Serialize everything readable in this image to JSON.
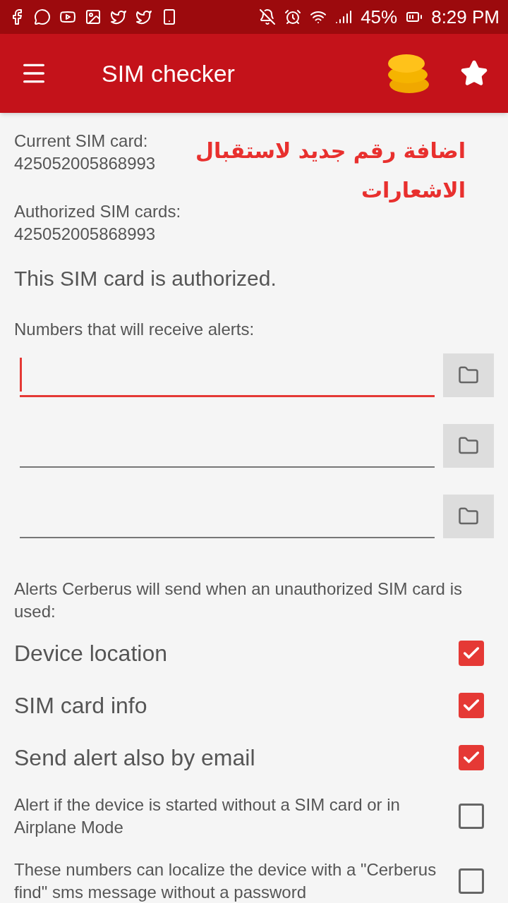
{
  "status_bar": {
    "battery": "45%",
    "time": "8:29 PM"
  },
  "app_bar": {
    "title": "SIM checker"
  },
  "annotation": "اضافة رقم جديد لاستقبال الاشعارات",
  "current_sim": {
    "label": "Current SIM card:",
    "value": "425052005868993"
  },
  "authorized_sims": {
    "label": "Authorized SIM cards:",
    "value": "425052005868993"
  },
  "status_message": "This SIM card is authorized.",
  "numbers_label": "Numbers that will receive alerts:",
  "number_fields": [
    {
      "focused": true
    },
    {
      "focused": false
    },
    {
      "focused": false
    }
  ],
  "alerts_label": "Alerts Cerberus will send when an unauthorized SIM card is used:",
  "options": [
    {
      "kind": "large",
      "label": "Device location",
      "checked": true
    },
    {
      "kind": "large",
      "label": "SIM card info",
      "checked": true
    },
    {
      "kind": "large",
      "label": "Send alert also by email",
      "checked": true
    },
    {
      "kind": "small",
      "label": "Alert if the device is started without a SIM card or in Airplane Mode",
      "checked": false
    },
    {
      "kind": "small",
      "label": "These numbers can localize the device with a \"Cerberus find\" sms message without a password",
      "checked": false
    }
  ]
}
